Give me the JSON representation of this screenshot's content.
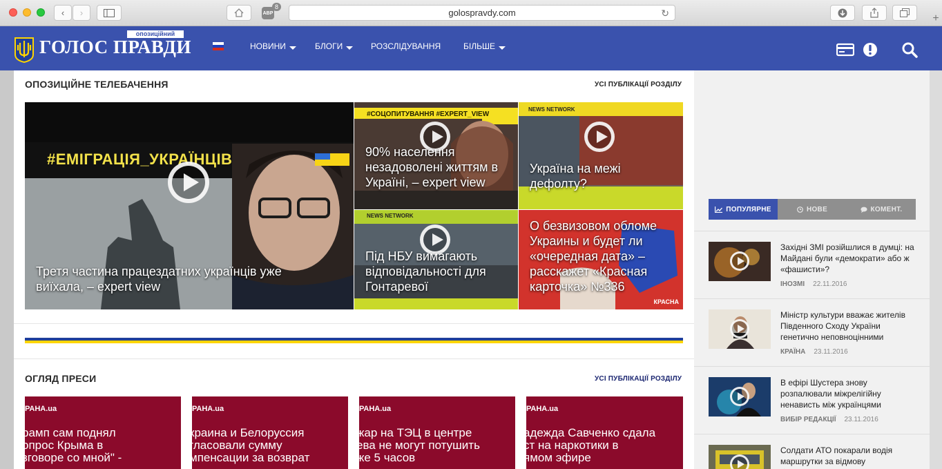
{
  "browser": {
    "url": "golospravdy.com",
    "adblock_count": "8",
    "adblock_label": "ABP"
  },
  "site": {
    "brand": "ГОЛОС ПРАВДИ",
    "tagline": "опозиційний",
    "nav": [
      {
        "label": "НОВИНИ",
        "dropdown": true
      },
      {
        "label": "БЛОГИ",
        "dropdown": true
      },
      {
        "label": "РОЗСЛІДУВАННЯ",
        "dropdown": false
      },
      {
        "label": "БІЛЬШЕ",
        "dropdown": true
      }
    ],
    "colors": {
      "header": "#3a52ad",
      "accent_blue": "#3a52ad",
      "ukraine_blue": "#1f3f9a",
      "ukraine_yellow": "#ffd500",
      "press_red": "#8b0a2b"
    }
  },
  "tv": {
    "title": "ОПОЗИЦІЙНЕ ТЕЛЕБАЧЕННЯ",
    "all_link": "УСІ ПУБЛІКАЦІЇ РОЗДІЛУ",
    "main": {
      "caption": "Третя частина працездатних українців уже виїхала, – expert view",
      "overlay": "#ЕМІГРАЦІЯ_УКРАЇНЦІВ"
    },
    "items": [
      {
        "caption": "90% населення незадоволені життям в Україні, – expert view",
        "overlay": "#СОЦОПИТУВАННЯ #EXPERT_VIEW"
      },
      {
        "caption": "Україна на межі дефолту?",
        "overlay": "NEWS NETWORK"
      },
      {
        "caption": "Під НБУ вимагають відповідальності для Гонтаревої",
        "overlay": "NEWS NETWORK"
      },
      {
        "caption": "О безвизовом обломе Украины и будет ли «очередная дата» – расскажет «Красная карточка» №336",
        "overlay": "КРАСНА"
      }
    ]
  },
  "press": {
    "title": "ОГЛЯД ПРЕСИ",
    "all_link": "УСІ ПУБЛІКАЦІЇ РОЗДІЛУ",
    "items": [
      {
        "source": "РАНА.ua",
        "text": "рамп сам поднял\nопрос Крыма в\nзговоре со мной\" -"
      },
      {
        "source": "РАНА.ua",
        "text": "краина и Белоруссия\nгласовали сумму\nмпенсации за возврат"
      },
      {
        "source": "РАНА.ua",
        "text": "жар на ТЭЦ в центре\nева не могут потушить\nже 5 часов"
      },
      {
        "source": "РАНА.ua",
        "text": "адежда Савченко сдала\nст на наркотики в\nямом эфире"
      }
    ]
  },
  "sidebar": {
    "tabs": [
      {
        "label": "ПОПУЛЯРНЕ",
        "active": true
      },
      {
        "label": "НОВЕ",
        "active": false
      },
      {
        "label": "КОМЕНТ.",
        "active": false
      }
    ],
    "items": [
      {
        "title": "Західні ЗМІ розійшлися в думці: на Майдані були «демократи» або ж «фашисти»?",
        "category": "ІНОЗМІ",
        "date": "22.11.2016"
      },
      {
        "title": "Міністр культури вважає жителів Південного Сходу України генетично неповноцінними",
        "category": "КРАЇНА",
        "date": "23.11.2016"
      },
      {
        "title": "В ефірі Шустера знову розпалювали міжрелігійну ненависть між українцями",
        "category": "ВИБІР РЕДАКЦІЇ",
        "date": "23.11.2016"
      },
      {
        "title": "Солдати АТО покарали водія маршрутки за відмову безкоштовно",
        "category": "",
        "date": ""
      }
    ]
  }
}
